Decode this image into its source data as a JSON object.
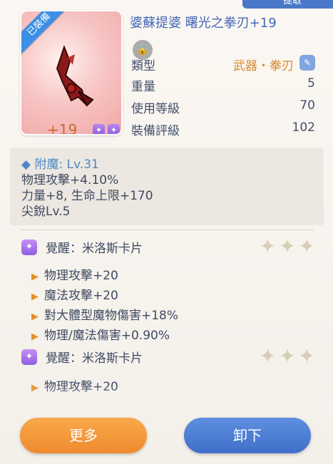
{
  "top_tab": {
    "label": "提取"
  },
  "item": {
    "equipped_label": "已裝備",
    "refine": "+19",
    "name": "婆蘇提婆 曙光之拳刃+19",
    "stats": [
      {
        "label": "類型",
        "value": "武器・拳刃"
      },
      {
        "label": "重量",
        "value": "5"
      },
      {
        "label": "使用等級",
        "value": "70"
      },
      {
        "label": "裝備評級",
        "value": "102"
      }
    ]
  },
  "enchant": {
    "header": "附魔: Lv.31",
    "lines": [
      "物理攻擊+4.10%",
      "力量+8, 生命上限+170",
      "尖銳Lv.5"
    ]
  },
  "awakenings": [
    {
      "label": "覺醒：米洛斯卡片",
      "effects": [
        "物理攻擊+20",
        "魔法攻擊+20",
        "對大體型魔物傷害+18%",
        "物理/魔法傷害+0.90%"
      ]
    },
    {
      "label": "覺醒：米洛斯卡片",
      "effects": [
        "物理攻擊+20"
      ]
    }
  ],
  "buttons": {
    "more": "更多",
    "unequip": "卸下"
  },
  "colors": {
    "accent_blue": "#4a78c8",
    "accent_orange": "#f08a2f",
    "title_blue": "#4468b8"
  }
}
